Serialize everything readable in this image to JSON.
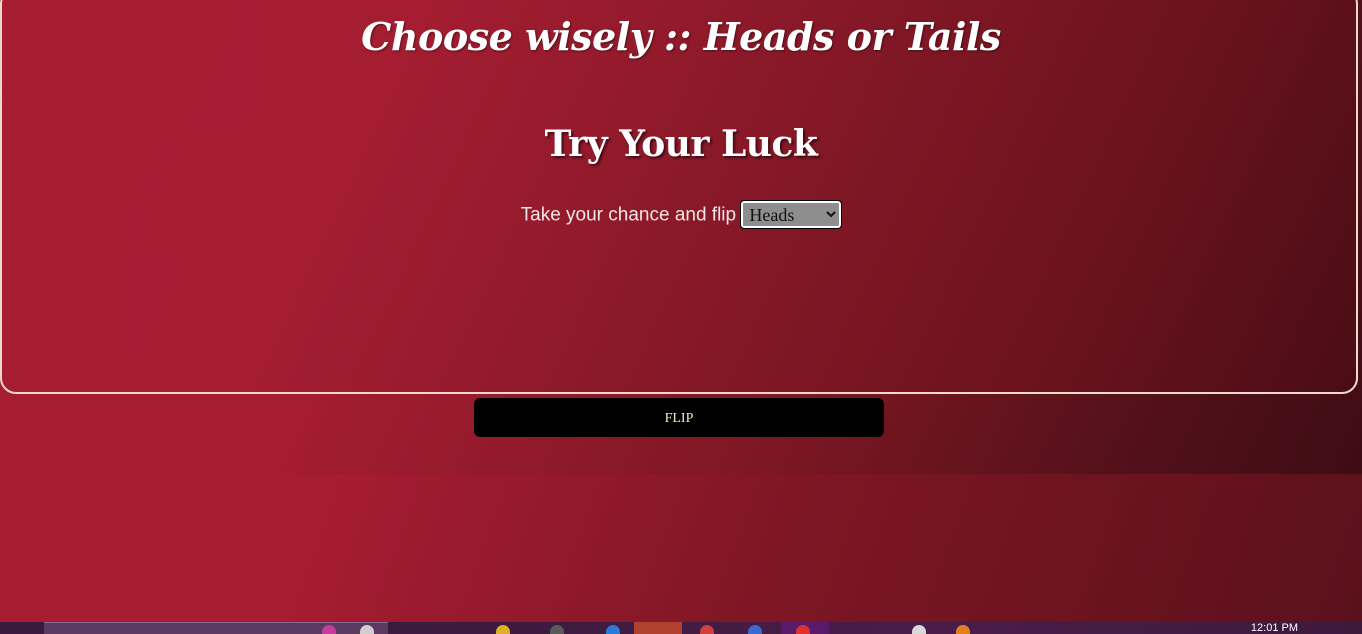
{
  "header": {
    "title": "Choose wisely :: Heads or Tails"
  },
  "main": {
    "heading": "Try Your Luck",
    "prompt_label": "Take your chance and flip",
    "select": {
      "selected": "Heads"
    },
    "flip_button_label": "FLIP"
  },
  "taskbar": {
    "clock_time": "12:01 PM"
  },
  "colors": {
    "accent_red": "#a61d31",
    "dark_red": "#4a0d15",
    "button_bg": "#000000",
    "button_text": "#f5e6b8",
    "card_border": "#f0d9c8"
  }
}
